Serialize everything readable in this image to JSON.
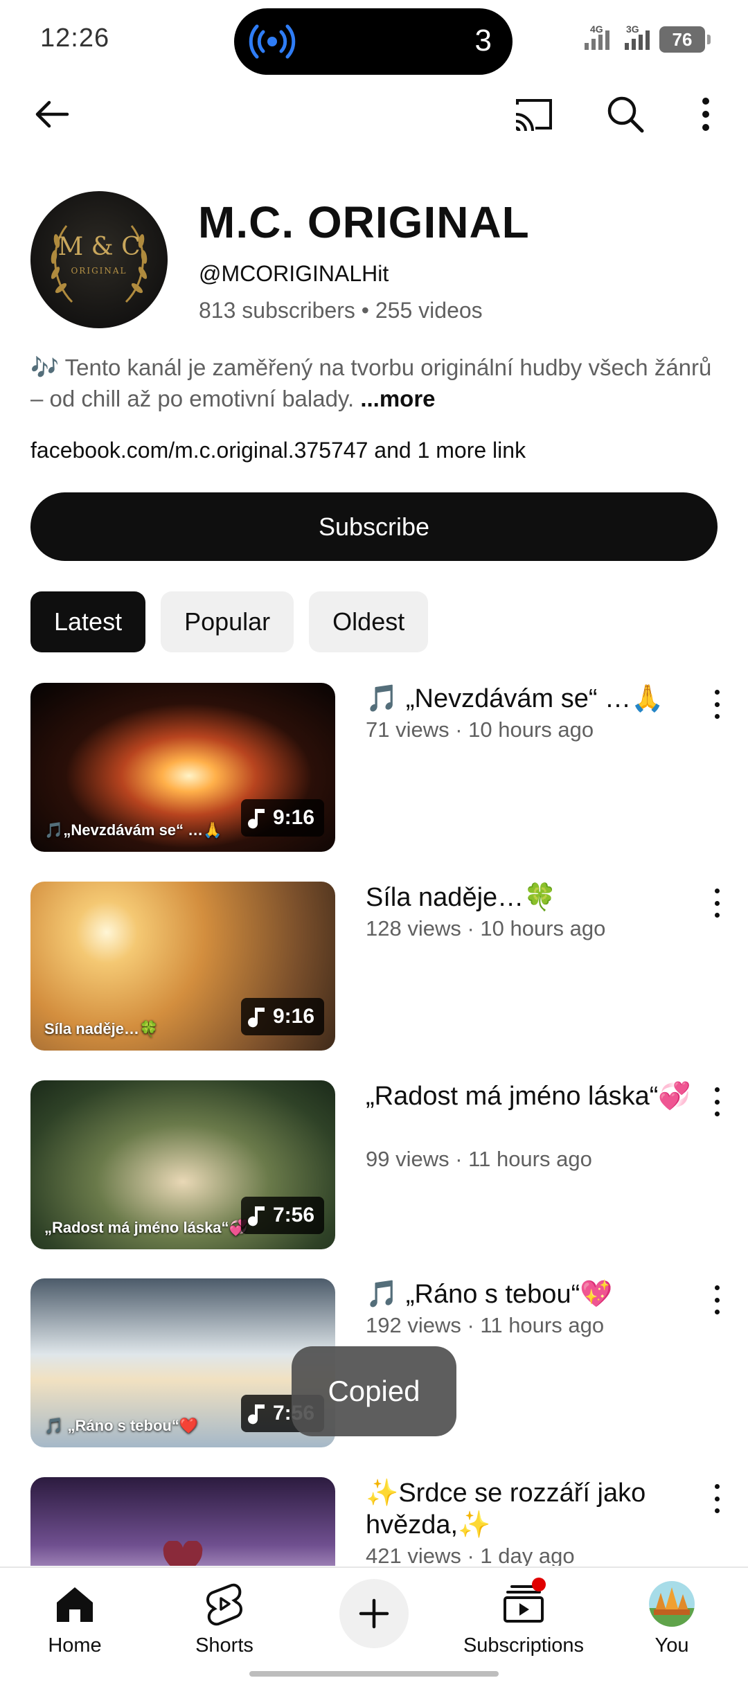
{
  "status": {
    "time": "12:26",
    "island_count": "3",
    "signal1_label": "4G",
    "signal2_label": "3G",
    "battery": "76"
  },
  "channel": {
    "name": "M.C. ORIGINAL",
    "handle": "@MCORIGINALHit",
    "stats": "813 subscribers • 255 videos",
    "description": "🎶 Tento kanál je zaměřený na tvorbu originální hudby všech žánrů – od chill až po emotivní balady.",
    "more": "...more",
    "links": "facebook.com/m.c.original.375747 and 1 more link",
    "subscribe_label": "Subscribe",
    "avatar_logo": "M & C",
    "avatar_sub": "ORIGINAL"
  },
  "chips": [
    "Latest",
    "Popular",
    "Oldest"
  ],
  "videos": [
    {
      "title": "🎵 „Nevzdávám se“ …🙏",
      "meta": "71 views · 10 hours ago",
      "duration": "9:16",
      "thumb_caption": "🎵„Nevzdávám se“ …🙏"
    },
    {
      "title": "Síla naděje…🍀",
      "meta": "128 views · 10 hours ago",
      "duration": "9:16",
      "thumb_caption": "Síla naděje…🍀"
    },
    {
      "title": "„Radost má jméno láska“💞",
      "meta": "99 views · 11 hours ago",
      "duration": "7:56",
      "thumb_caption": "„Radost má jméno láska“💞"
    },
    {
      "title": "🎵 „Ráno s tebou“💖",
      "meta": "192 views · 11 hours ago",
      "duration": "7:56",
      "thumb_caption": "🎵 „Ráno s tebou“❤️"
    },
    {
      "title": "✨Srdce se rozzáří jako hvězda,✨",
      "meta": "421 views · 1 day ago",
      "duration": "",
      "thumb_caption": ""
    }
  ],
  "toast": "Copied",
  "nav": {
    "home": "Home",
    "shorts": "Shorts",
    "subscriptions": "Subscriptions",
    "you": "You"
  },
  "colors": {
    "text": "#0f0f0f",
    "secondary": "#606060",
    "chip_bg": "#f0f0f0",
    "accent_blue": "#1a73e8",
    "notification_red": "#e00000"
  }
}
